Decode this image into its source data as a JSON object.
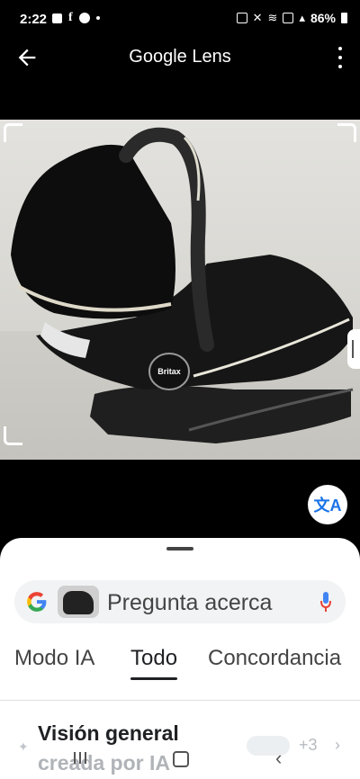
{
  "status_bar": {
    "time": "2:22",
    "left_icons": [
      "gallery-icon",
      "facebook-icon",
      "account-icon",
      "dot-icon"
    ],
    "right_icons": [
      "nfc-icon",
      "mute-icon",
      "wifi-icon",
      "volte-icon",
      "signal-icon"
    ],
    "battery": "86%"
  },
  "app_bar": {
    "title": "Google Lens",
    "back_icon": "arrow-left-icon",
    "menu_icon": "more-vert-icon"
  },
  "photo": {
    "subject": "Britax infant car seat",
    "brand_label": "Britax"
  },
  "translate_button_icon": "translate-icon",
  "sheet": {
    "search_placeholder": "Pregunta acerca",
    "tabs": [
      {
        "label": "Modo IA",
        "active": false
      },
      {
        "label": "Todo",
        "active": true
      },
      {
        "label": "Concordancia",
        "active": false
      }
    ],
    "overview_title_line1": "Visión general",
    "overview_title_line2": "creada por IA",
    "sources_more": "+3"
  },
  "colors": {
    "accent_blue": "#1a73e8",
    "mic_red": "#ea4335"
  }
}
